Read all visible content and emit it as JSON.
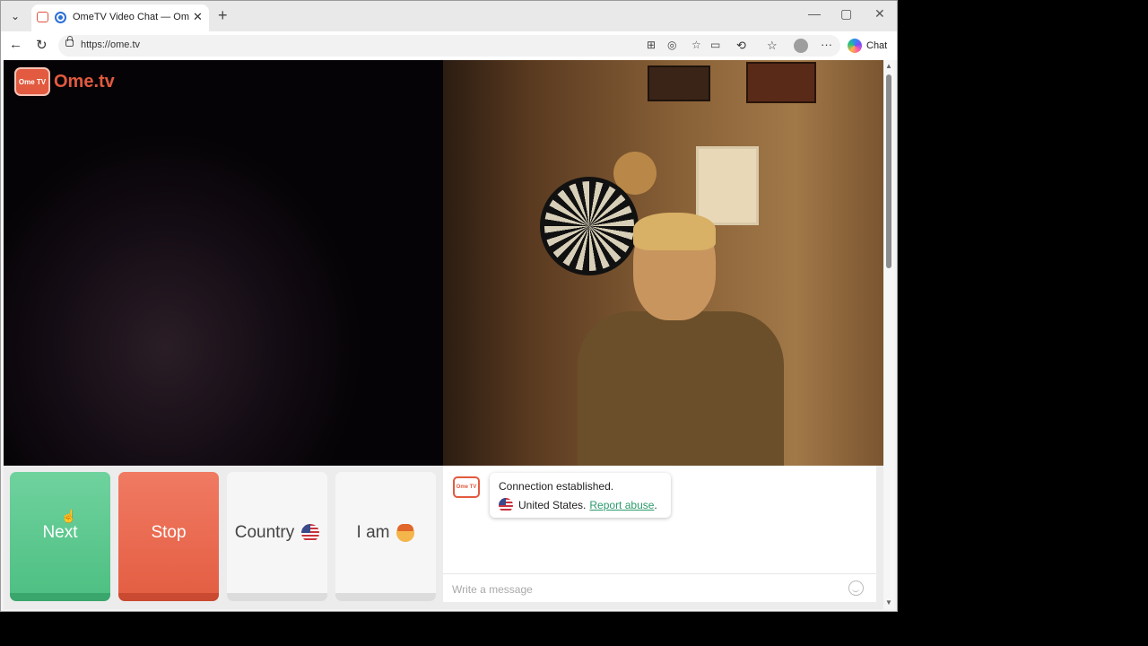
{
  "browser": {
    "tab_title": "OmeTV Video Chat — Omegl",
    "url": "https://ome.tv",
    "chat_label": "Chat",
    "icons": [
      "tab-menu-icon",
      "favicon-ometv-icon",
      "favicon-loading-icon",
      "close-icon",
      "new-tab-icon",
      "minimize-icon",
      "maximize-icon",
      "window-close-icon",
      "back-icon",
      "reload-icon",
      "lock-icon",
      "split-screen-icon",
      "sidebar-icon",
      "favorite-icon",
      "video-icon",
      "extensions-icon",
      "favorites-list-icon",
      "profile-icon",
      "more-icon",
      "copilot-icon"
    ]
  },
  "logo": {
    "badge": "Ome TV",
    "text": "Ome.tv"
  },
  "controls": {
    "next_label": "Next",
    "stop_label": "Stop",
    "country_label": "Country",
    "iam_label": "I am"
  },
  "chat": {
    "logo_badge": "Ome TV",
    "status": "Connection established.",
    "country": "United States.",
    "report_link": "Report abuse",
    "report_suffix": ".",
    "placeholder": "Write a message"
  },
  "colors": {
    "brand": "#e25a3f",
    "next": "#56c48a",
    "stop": "#e8664b",
    "link": "#2b9a6a"
  }
}
